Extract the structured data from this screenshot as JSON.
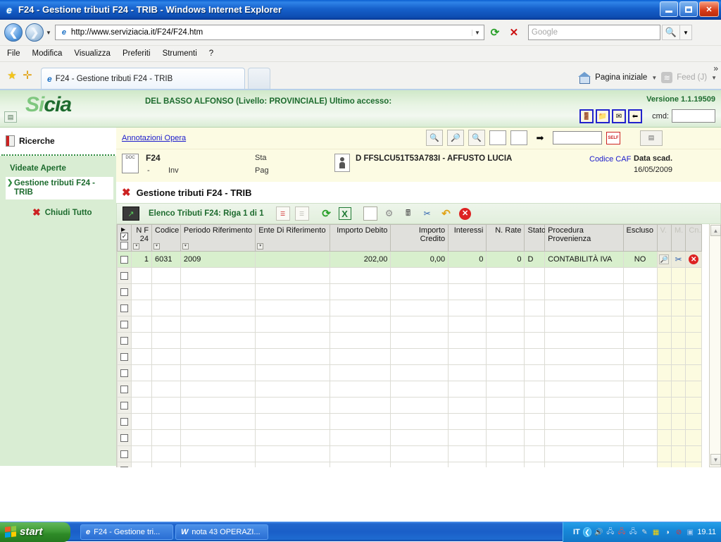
{
  "window": {
    "title": "F24 - Gestione tributi F24 - TRIB - Windows Internet Explorer",
    "minimize_label": "Riduci a icona",
    "maximize_label": "Ripristina",
    "close_label": "Chiudi"
  },
  "browser": {
    "back_glyph": "←",
    "forward_glyph": "→",
    "url": "http://www.serviziacia.it/F24/F24.htm",
    "url_display": "http://www.serviziacia.it/F24/F24.htm",
    "refresh_glyph": "↻",
    "stop_glyph": "✕",
    "search_placeholder": "Google",
    "search_glyph": "🔍",
    "menu": [
      "File",
      "Modifica",
      "Visualizza",
      "Preferiti",
      "Strumenti",
      "?"
    ],
    "tab_label": "F24 - Gestione tributi F24 - TRIB",
    "home_label": "Pagina iniziale",
    "feed_label": "Feed (J)",
    "overflow_glyph": "»"
  },
  "app_header": {
    "logo_part1": "Si",
    "logo_part2": "cia",
    "user_line": "DEL BASSO ALFONSO (Livello: PROVINCIALE) Ultimo accesso:",
    "version": "Versione 1.1.19509",
    "cmd_label": "cmd:",
    "cmd_value": "",
    "icons": [
      "door-icon",
      "folder-star-icon",
      "envelope-icon",
      "logout-icon"
    ]
  },
  "sidebar": {
    "search_label": "Ricerche",
    "open_views_label": "Videate Aperte",
    "open_items": [
      {
        "label": "Gestione tributi F24 - TRIB"
      }
    ],
    "close_all_label": "Chiudi Tutto"
  },
  "annotations": {
    "link": "Annotazioni Opera",
    "input_value": "",
    "field1": "",
    "field2": "",
    "self_badge": "SELF"
  },
  "document_bar": {
    "type": "F24",
    "dash": "-",
    "inv_label": "Inv",
    "sta_label": "Sta",
    "pag_label": "Pag",
    "subject": "D FFSLCU51T53A783I - AFFUSTO LUCIA",
    "caf_label": "Codice CAF",
    "due_label": "Data scad.",
    "due_value": "16/05/2009"
  },
  "page": {
    "title": "Gestione tributi F24 - TRIB",
    "grid_title": "Elenco Tributi F24: Riga 1 di 1"
  },
  "chart_data": {
    "type": "table",
    "title": "Elenco Tributi F24: Riga 1 di 1",
    "columns": [
      "N F 24",
      "Codice",
      "Periodo Riferimento",
      "Ente Di Riferimento",
      "Importo Debito",
      "Importo Credito",
      "Interessi",
      "N. Rate",
      "Stato",
      "Procedura Provenienza",
      "Escluso",
      "V.",
      "M.",
      "Cn."
    ],
    "rows": [
      {
        "n_f24": "1",
        "codice": "6031",
        "periodo_riferimento": "2009",
        "ente_di_riferimento": "",
        "importo_debito": "202,00",
        "importo_credito": "0,00",
        "interessi": "0",
        "n_rate": "0",
        "stato": "D",
        "procedura_provenienza": "CONTABILITÀ IVA",
        "escluso": "NO"
      }
    ],
    "empty_row_count": 13
  },
  "table": {
    "headers": [
      {
        "label": "N F 24",
        "align": "right",
        "filter": true
      },
      {
        "label": "Codice",
        "align": "left",
        "filter": true
      },
      {
        "label": "Periodo Riferimento",
        "align": "left",
        "filter": true
      },
      {
        "label": "Ente Di Riferimento",
        "align": "left",
        "filter": true
      },
      {
        "label": "Importo Debito",
        "align": "right",
        "filter": false
      },
      {
        "label": "Importo Credito",
        "align": "right",
        "filter": false
      },
      {
        "label": "Interessi",
        "align": "right",
        "filter": false
      },
      {
        "label": "N. Rate",
        "align": "right",
        "filter": false
      },
      {
        "label": "Stato",
        "align": "left",
        "filter": false
      },
      {
        "label": "Procedura Provenienza",
        "align": "left",
        "filter": false
      },
      {
        "label": "Escluso",
        "align": "left",
        "filter": false
      },
      {
        "label": "V.",
        "align": "left",
        "filter": false
      },
      {
        "label": "M.",
        "align": "left",
        "filter": false
      },
      {
        "label": "Cn.",
        "align": "left",
        "filter": false
      }
    ],
    "row": {
      "n_f24": "1",
      "codice": "6031",
      "periodo": "2009",
      "ente": "",
      "debito": "202,00",
      "credito": "0,00",
      "interessi": "0",
      "rate": "0",
      "stato": "D",
      "procedura": "CONTABILITÀ IVA",
      "escluso": "NO"
    }
  },
  "taskbar": {
    "start_label": "start",
    "tasks": [
      {
        "label": "F24 - Gestione tri...",
        "icon": "ie-icon"
      },
      {
        "label": "nota 43  OPERAZI...",
        "icon": "word-icon"
      }
    ],
    "lang": "IT",
    "clock": "19.11"
  },
  "colors": {
    "accent_green": "#1d6b2e",
    "header_bg": "#d9edd3",
    "row_selected": "#d8efcd",
    "yellow_panel": "#fcfbe3",
    "title_blue": "#1661cc"
  }
}
